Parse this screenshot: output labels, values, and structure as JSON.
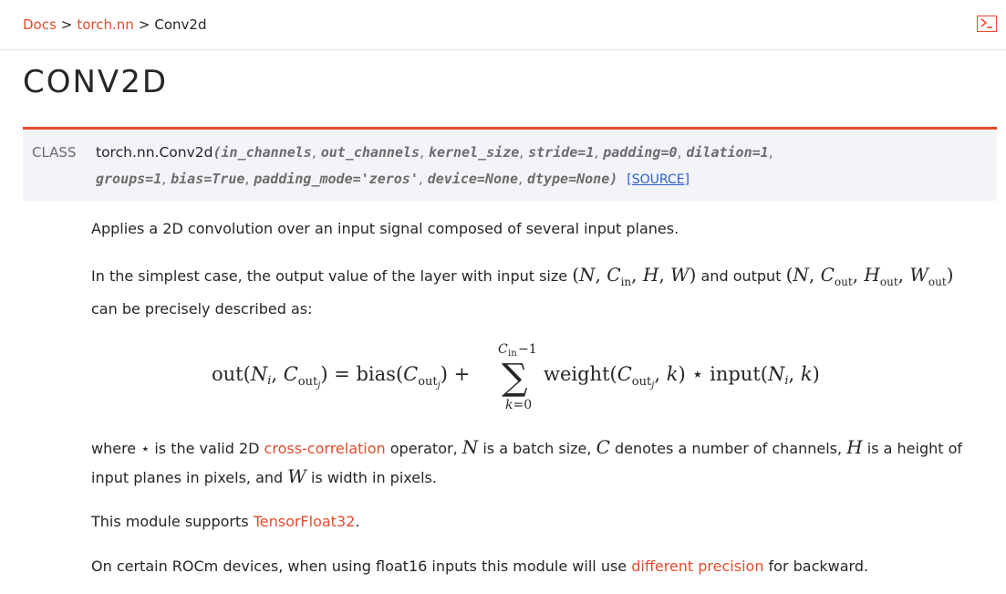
{
  "breadcrumb": {
    "docs": "Docs",
    "sep1": ">",
    "nn": "torch.nn",
    "sep2": ">",
    "current": "Conv2d"
  },
  "page_title": "CONV2D",
  "signature": {
    "kind": "CLASS",
    "name": "torch.nn.Conv2d",
    "open_paren": "(",
    "p1": "in_channels",
    "p2": "out_channels",
    "p3": "kernel_size",
    "p4": "stride=1",
    "p5": "padding=0",
    "p6": "dilation=1",
    "p7": "groups=1",
    "p8": "bias=True",
    "p9": "padding_mode='zeros'",
    "p10": "device=None",
    "p11": "dtype=None",
    "close_paren": ")",
    "source_label": "[SOURCE]"
  },
  "para1": "Applies a 2D convolution over an input signal composed of several input planes.",
  "para2": {
    "a": "In the simplest case, the output value of the layer with input size",
    "b": "and output",
    "c": "can be precisely described as:"
  },
  "para3": {
    "a": "where ⋆ is the valid 2D",
    "link": "cross-correlation",
    "b": "operator,",
    "c": "is a batch size,",
    "d": "denotes a number of channels,",
    "e": "is a height of",
    "f": "input planes in pixels, and",
    "g": "is width in pixels."
  },
  "para4": {
    "a": "This module supports",
    "link": "TensorFloat32",
    "b": "."
  },
  "para5": {
    "a": "On certain ROCm devices, when using float16 inputs this module will use",
    "link": "different precision",
    "b": "for backward."
  },
  "colors": {
    "accent": "#e44c2c",
    "source_link": "#2b5ed3",
    "signature_bg": "#f3f4f7"
  },
  "icons": {
    "terminal": "terminal-icon"
  }
}
